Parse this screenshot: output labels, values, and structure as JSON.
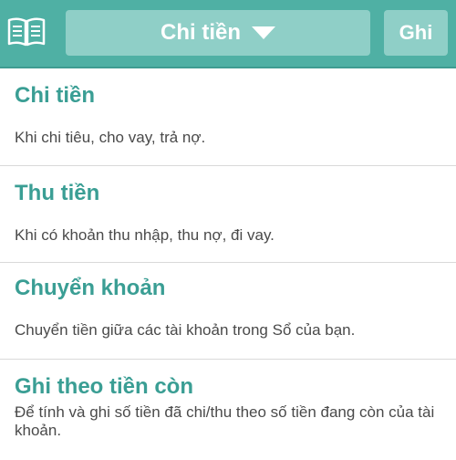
{
  "header": {
    "book_icon": "open-book-icon",
    "dropdown_label": "Chi tiền",
    "dropdown_icon": "caret-down-icon",
    "save_label": "Ghi"
  },
  "menu": {
    "items": [
      {
        "title": "Chi tiền",
        "description": "Khi chi tiêu, cho vay, trả nợ."
      },
      {
        "title": "Thu tiền",
        "description": "Khi có khoản thu nhập, thu nợ, đi vay."
      },
      {
        "title": "Chuyển khoản",
        "description": "Chuyển tiền giữa các tài khoản trong Sổ của bạn."
      },
      {
        "title": "Ghi theo tiền còn",
        "description": "Để tính và ghi số tiền đã chi/thu theo số tiền đang còn của tài khoản."
      }
    ]
  },
  "colors": {
    "header_bg": "#4fb0a4",
    "button_bg": "#8fcfc7",
    "title_text": "#3a9e94"
  }
}
